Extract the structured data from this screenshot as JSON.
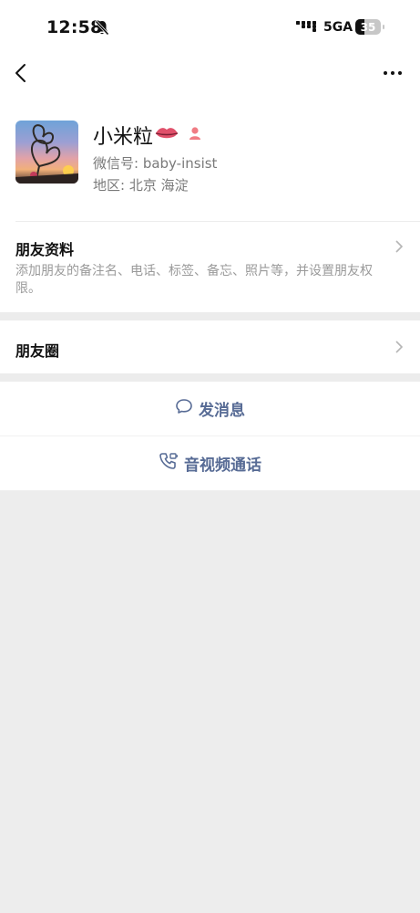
{
  "status_bar": {
    "time": "12:58",
    "network": "5GA",
    "battery": "35"
  },
  "profile": {
    "name": "小米粒",
    "name_emoji": "👄",
    "wechat_id": "微信号: baby-insist",
    "region": "地区: 北京 海淀"
  },
  "friend_info": {
    "title": "朋友资料",
    "description": "添加朋友的备注名、电话、标签、备忘、照片等，并设置朋友权限。"
  },
  "moments": {
    "title": "朋友圈"
  },
  "actions": {
    "message": "发消息",
    "call": "音视频通话"
  },
  "colors": {
    "link": "#576b95",
    "background": "#ededed"
  }
}
